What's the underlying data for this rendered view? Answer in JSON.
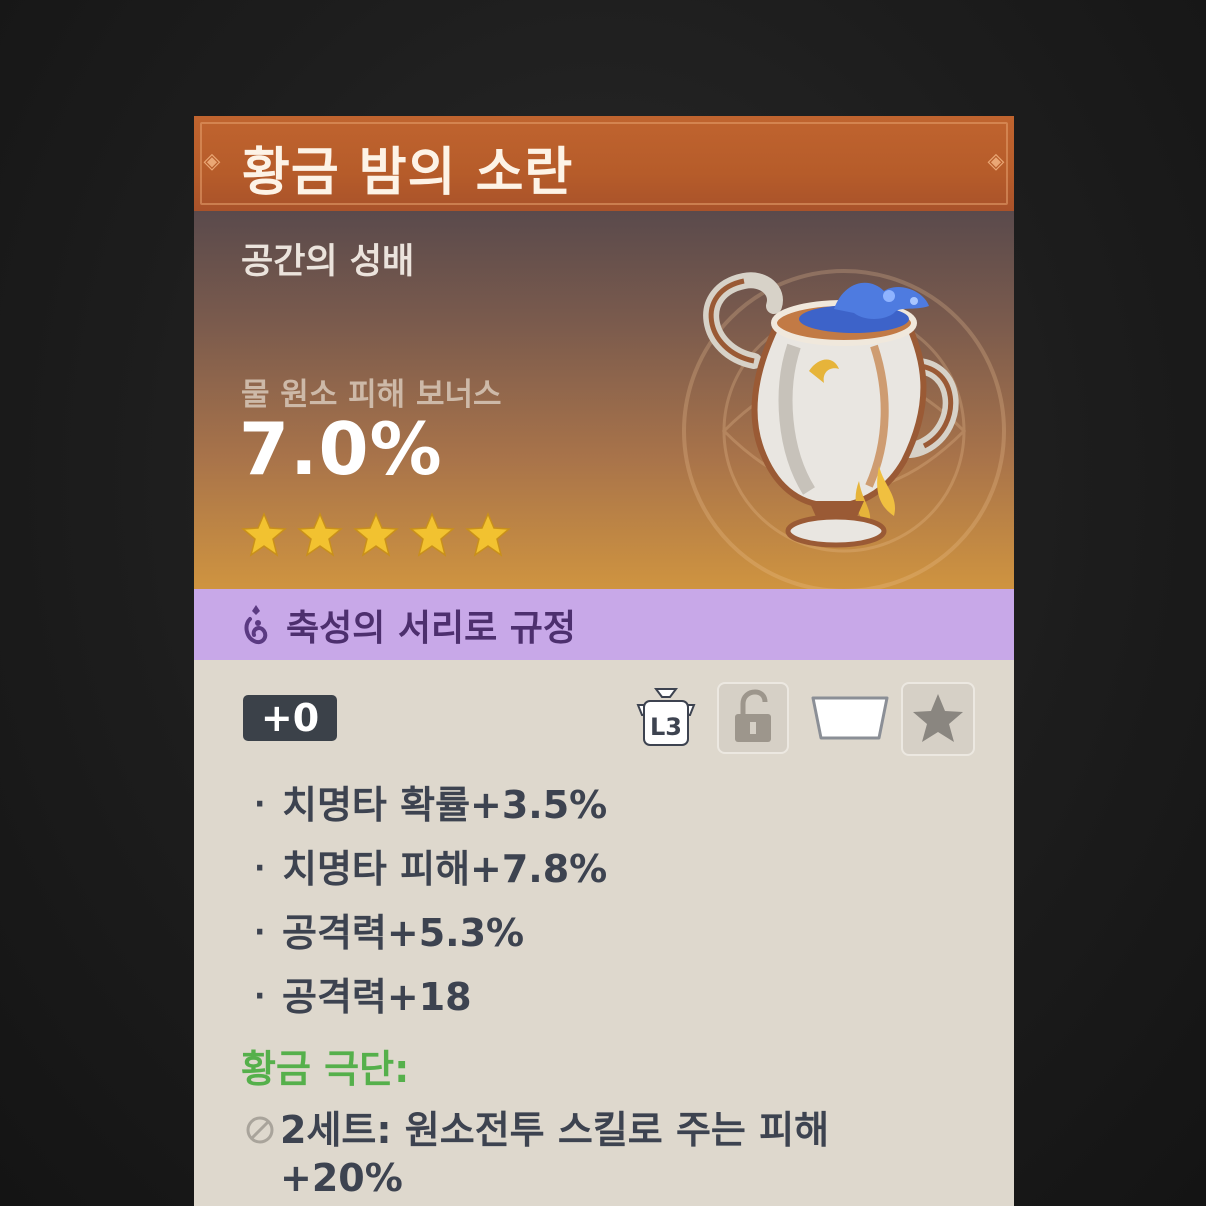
{
  "artifact": {
    "name": "황금 밤의 소란",
    "slot": "공간의 성배",
    "main_stat": {
      "label": "물 원소 피해 보너스",
      "value": "7.0%"
    },
    "rarity_stars": 5,
    "icon": "cup-of-water-artifact-icon"
  },
  "set_banner": {
    "icon": "sanctifying-elixir-icon",
    "text": "축성의 서리로 규정"
  },
  "level": "+0",
  "toolbar": {
    "level_cap_label": "L3",
    "lock_icon": "unlocked-lock-icon",
    "tag_icon": "blank-tag-icon",
    "favorite_icon": "star-icon"
  },
  "substats": [
    "치명타 확률+3.5%",
    "치명타 피해+7.8%",
    "공격력+5.3%",
    "공격력+18"
  ],
  "set": {
    "name": "황금 극단:",
    "effect_2pc": "2세트: 원소전투 스킬로 주는 피해+20%"
  },
  "colors": {
    "title_bar": "#b65c2a",
    "set_banner": "#c8a8e8",
    "set_name": "#55b04b",
    "star": "#f2c230",
    "body": "#ded8cd"
  }
}
